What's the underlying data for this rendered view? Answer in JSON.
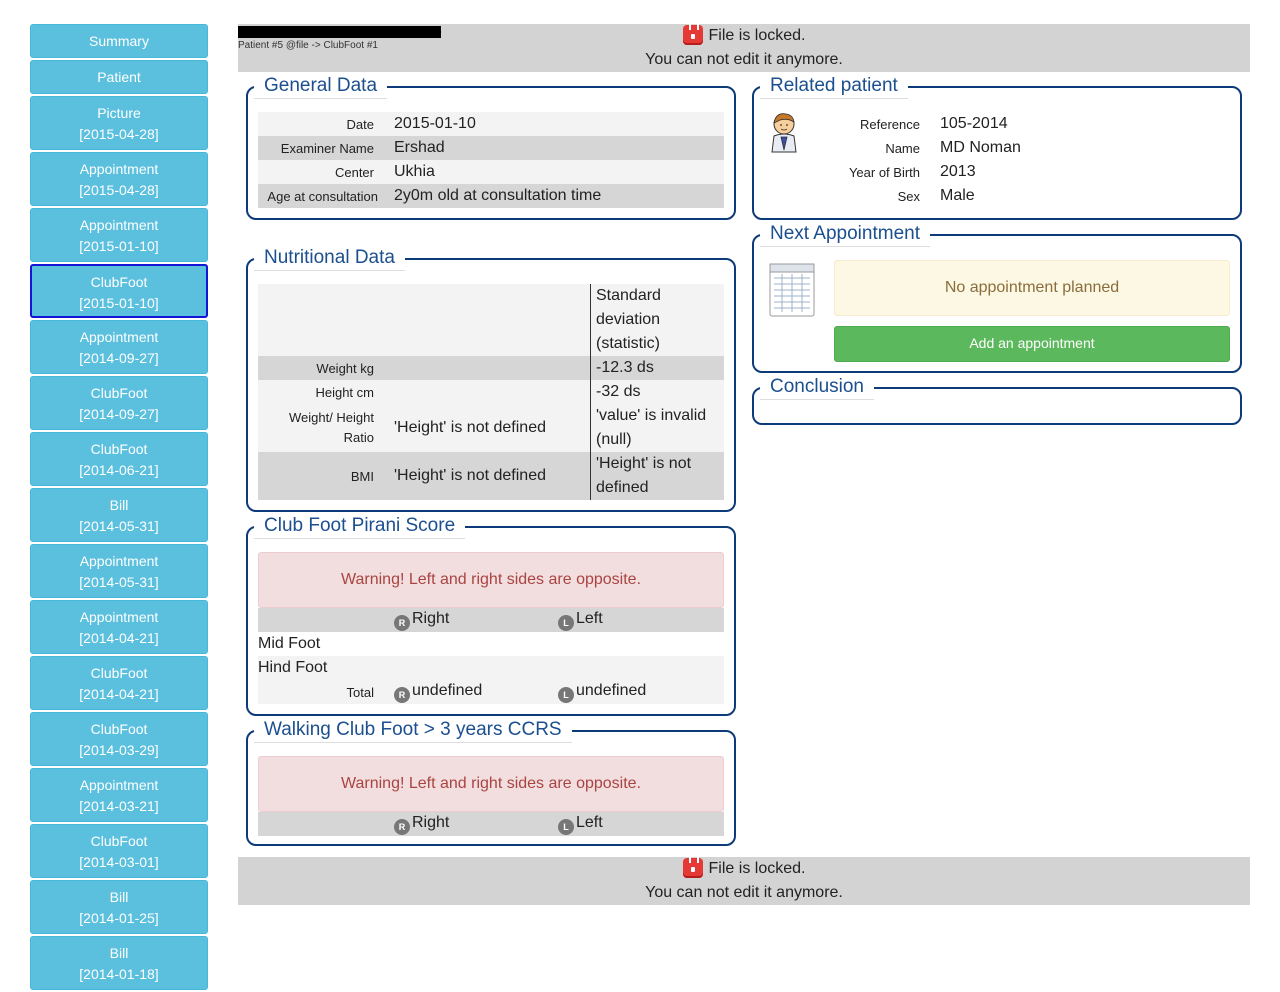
{
  "sidebar": {
    "items": [
      {
        "label": "Summary",
        "date": ""
      },
      {
        "label": "Patient",
        "date": ""
      },
      {
        "label": "Picture",
        "date": "[2015-04-28]"
      },
      {
        "label": "Appointment",
        "date": "[2015-04-28]"
      },
      {
        "label": "Appointment",
        "date": "[2015-01-10]"
      },
      {
        "label": "ClubFoot",
        "date": "[2015-01-10]"
      },
      {
        "label": "Appointment",
        "date": "[2014-09-27]"
      },
      {
        "label": "ClubFoot",
        "date": "[2014-09-27]"
      },
      {
        "label": "ClubFoot",
        "date": "[2014-06-21]"
      },
      {
        "label": "Bill",
        "date": "[2014-05-31]"
      },
      {
        "label": "Appointment",
        "date": "[2014-05-31]"
      },
      {
        "label": "Appointment",
        "date": "[2014-04-21]"
      },
      {
        "label": "ClubFoot",
        "date": "[2014-04-21]"
      },
      {
        "label": "ClubFoot",
        "date": "[2014-03-29]"
      },
      {
        "label": "Appointment",
        "date": "[2014-03-21]"
      },
      {
        "label": "ClubFoot",
        "date": "[2014-03-01]"
      },
      {
        "label": "Bill",
        "date": "[2014-01-25]"
      },
      {
        "label": "Bill",
        "date": "[2014-01-18]"
      }
    ]
  },
  "locked": {
    "line1": "File is locked.",
    "line2": "You can not edit it anymore."
  },
  "breadcrumb": "Patient #5 @file -> ClubFoot #1",
  "general": {
    "title": "General Data",
    "rows": [
      {
        "label": "Date",
        "value": "2015-01-10"
      },
      {
        "label": "Examiner Name",
        "value": "Ershad"
      },
      {
        "label": "Center",
        "value": "Ukhia"
      },
      {
        "label": "Age at consultation",
        "value": "2y0m old at consultation time"
      }
    ]
  },
  "nutrition": {
    "title": "Nutritional Data",
    "header": "Standard deviation (statistic)",
    "weight_label": "Weight kg",
    "weight_sd": "-12.3 ds",
    "height_label": "Height cm",
    "height_sd": "-32 ds",
    "wh_label": "Weight/ Height Ratio",
    "wh_value": "'Height' is not defined",
    "wh_sd": "'value' is invalid (null)",
    "bmi_label": "BMI",
    "bmi_value": "'Height' is not defined",
    "bmi_sd": "'Height' is not defined"
  },
  "pirani": {
    "title": "Club Foot Pirani Score",
    "warning": "Warning! Left and right sides are opposite.",
    "right_badge": "R",
    "left_badge": "L",
    "right": "Right",
    "left": "Left",
    "mid": "Mid Foot",
    "hind": "Hind Foot",
    "total": "Total",
    "total_right": "undefined",
    "total_left": "undefined"
  },
  "walking": {
    "title": "Walking Club Foot > 3 years CCRS",
    "warning": "Warning! Left and right sides are opposite.",
    "right_badge": "R",
    "left_badge": "L",
    "right": "Right",
    "left": "Left"
  },
  "related": {
    "title": "Related patient",
    "rows": [
      {
        "label": "Reference",
        "value": "105-2014"
      },
      {
        "label": "Name",
        "value": "MD Noman"
      },
      {
        "label": "Year of Birth",
        "value": "2013"
      },
      {
        "label": "Sex",
        "value": "Male"
      }
    ]
  },
  "next": {
    "title": "Next Appointment",
    "message": "No appointment planned",
    "button": "Add an appointment"
  },
  "conclusion": {
    "title": "Conclusion"
  }
}
